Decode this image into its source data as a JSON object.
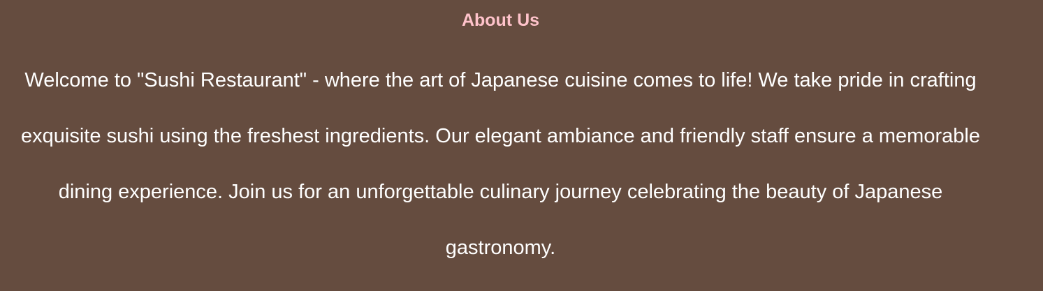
{
  "about": {
    "title": "About Us",
    "description": "Welcome to \"Sushi Restaurant\" - where the art of Japanese cuisine comes to life! We take pride in crafting exquisite sushi using the freshest ingredients. Our elegant ambiance and friendly staff ensure a memorable dining experience. Join us for an unforgettable culinary journey celebrating the beauty of Japanese gastronomy."
  },
  "colors": {
    "background": "#654c3f",
    "heading": "#ffc3cb",
    "body_text": "#ffffff"
  }
}
